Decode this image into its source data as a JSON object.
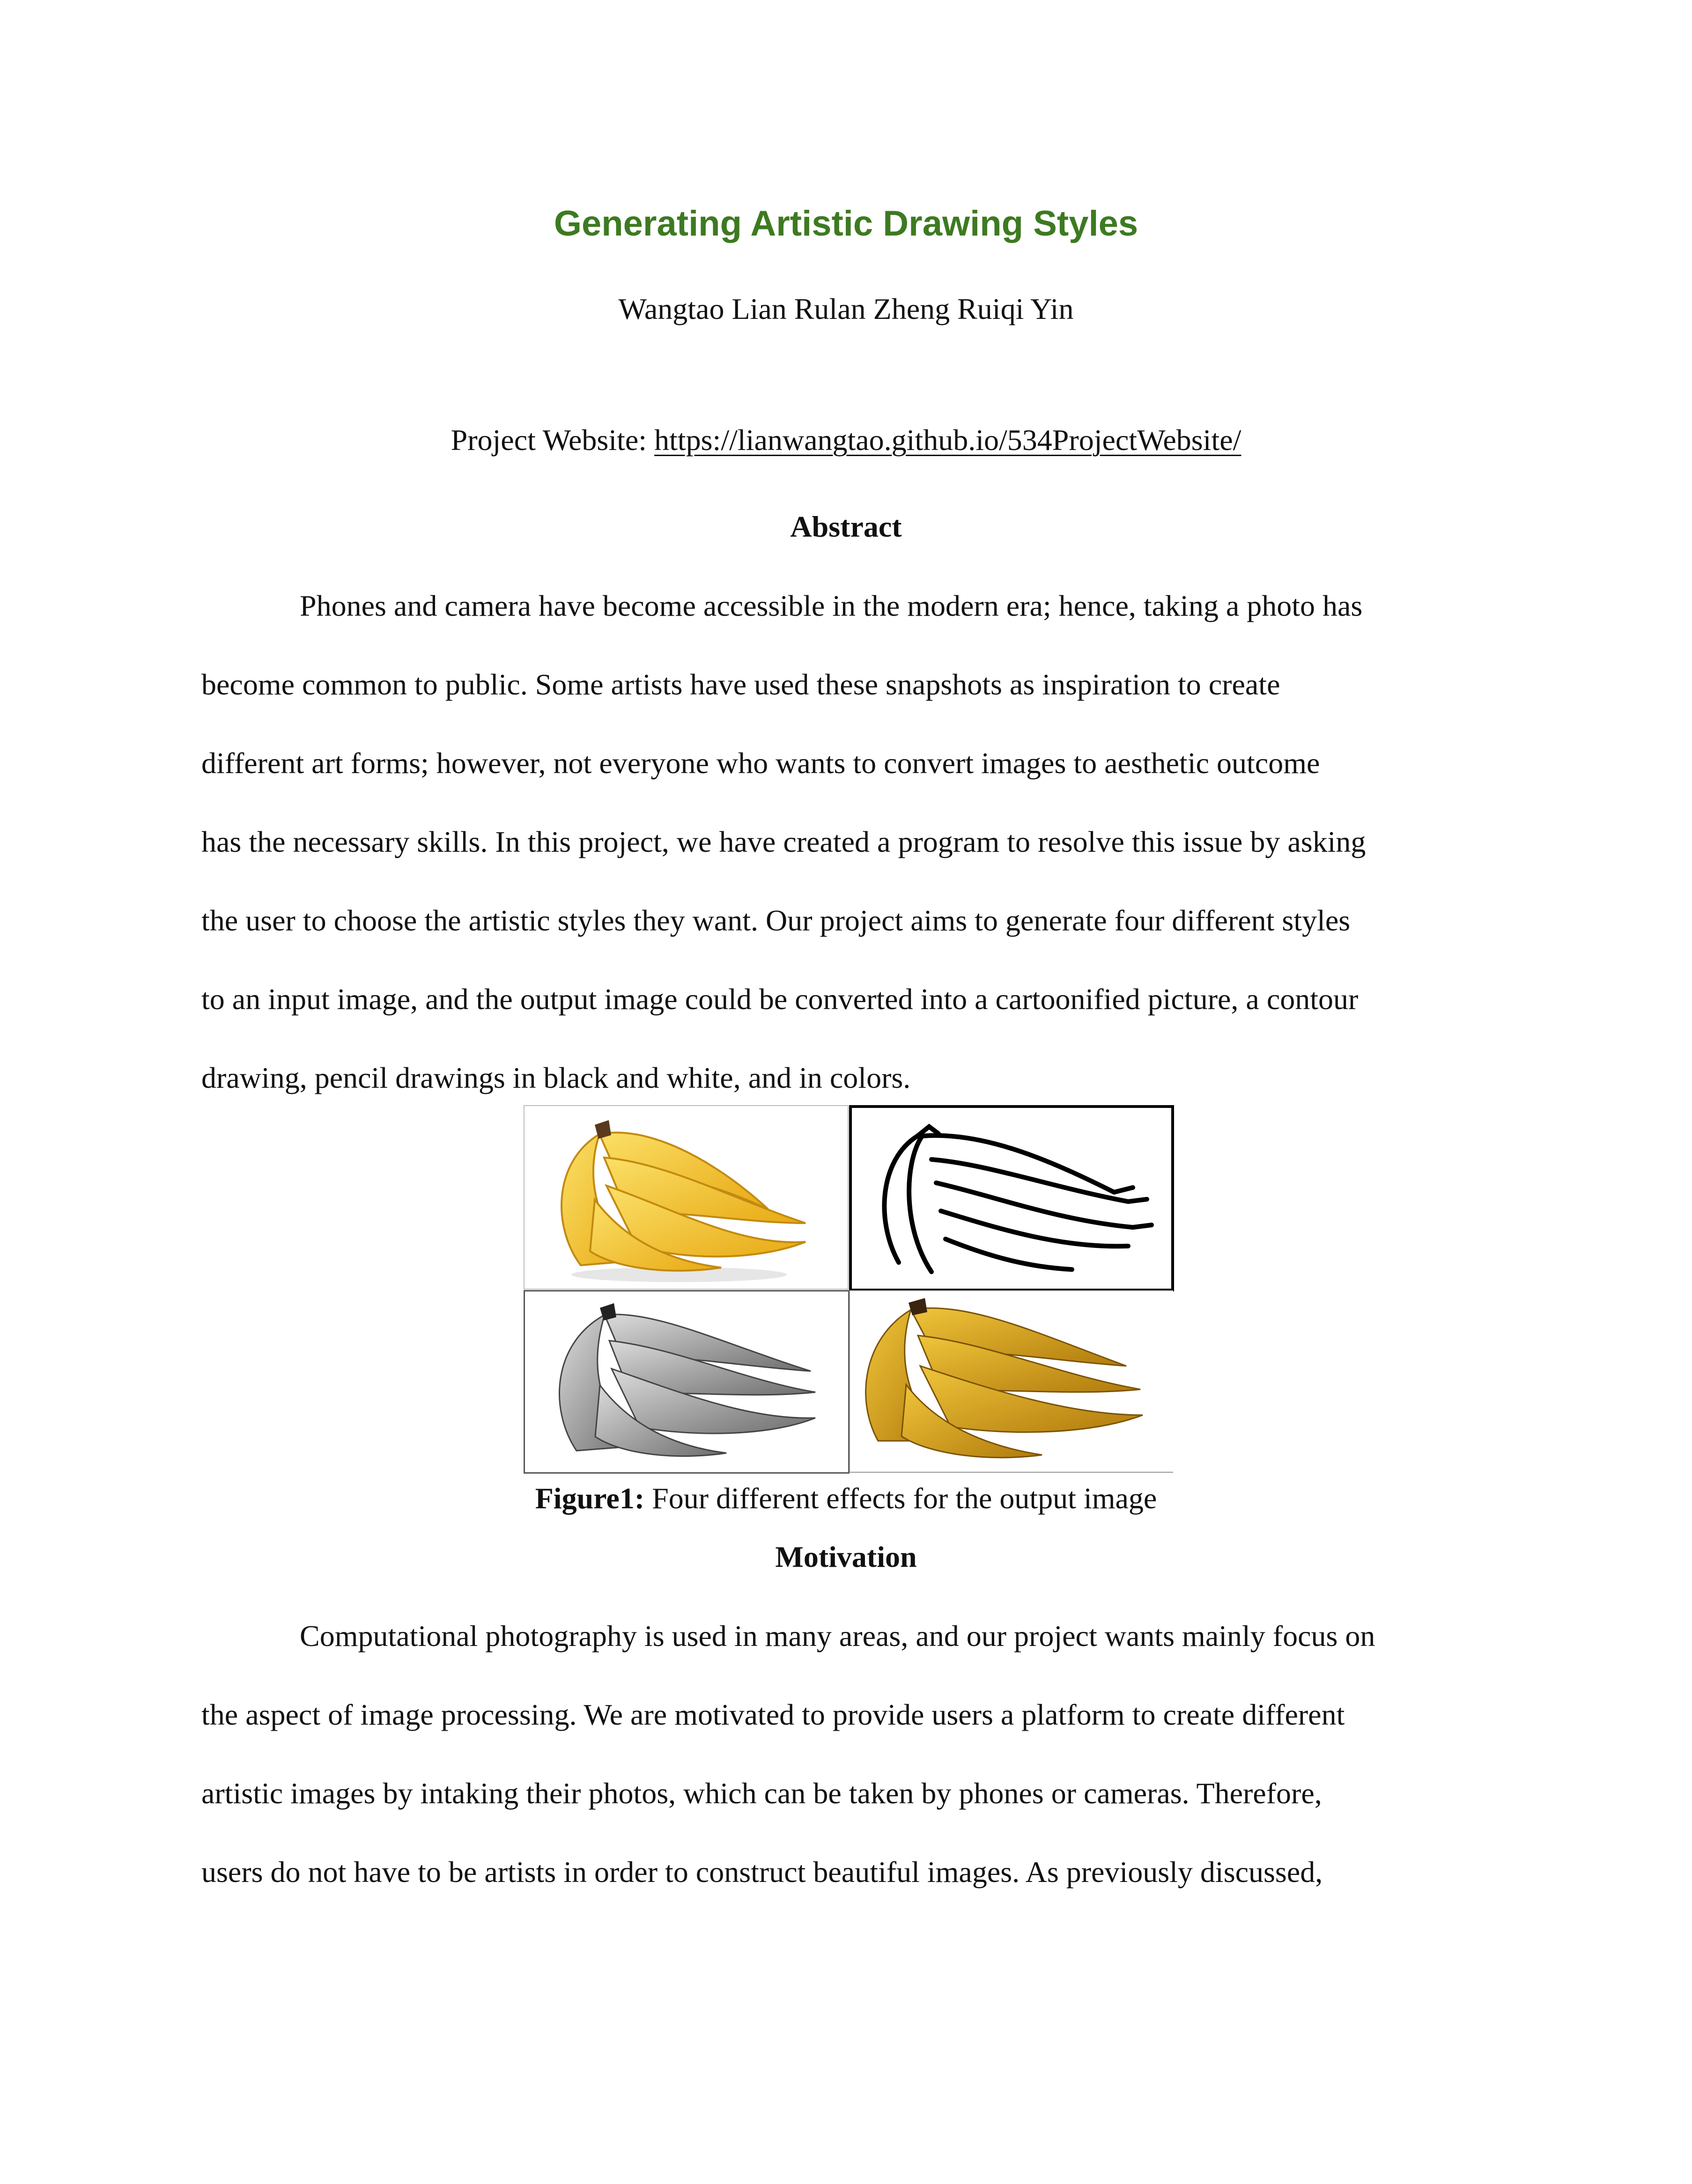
{
  "paper": {
    "title": "Generating Artistic Drawing Styles",
    "authors": "Wangtao Lian  Rulan Zheng  Ruiqi Yin",
    "website_label": "Project Website: ",
    "website_url": "https://lianwangtao.github.io/534ProjectWebsite/"
  },
  "abstract": {
    "heading": "Abstract",
    "lines": [
      "Phones and camera have become accessible in the modern era; hence, taking a photo has",
      "become common to public. Some artists have used these snapshots as inspiration to create",
      "different art forms; however, not everyone who wants to convert images to aesthetic outcome",
      "has the necessary skills. In this project, we have created a program to resolve this issue by asking",
      "the user to choose the artistic styles they want. Our project aims to generate four different styles",
      "to an input image, and the output image could be converted into a cartoonified picture, a contour",
      "drawing, pencil drawings in black and white, and in colors."
    ]
  },
  "figure": {
    "label": "Figure1:",
    "caption": " Four different effects for the output image"
  },
  "motivation": {
    "heading": "Motivation",
    "lines": [
      "Computational photography is used in many areas, and our project wants mainly focus on",
      "the aspect of image processing. We are motivated to provide users a platform to create different",
      "artistic images by intaking their photos, which can be taken by phones or cameras. Therefore,",
      "users do not have to be artists in order to construct beautiful images. As previously discussed,"
    ]
  },
  "colors": {
    "title": "#3d7a21",
    "banana_cartoon": "#f5c826",
    "banana_pencil_color": "#d9a21a"
  }
}
